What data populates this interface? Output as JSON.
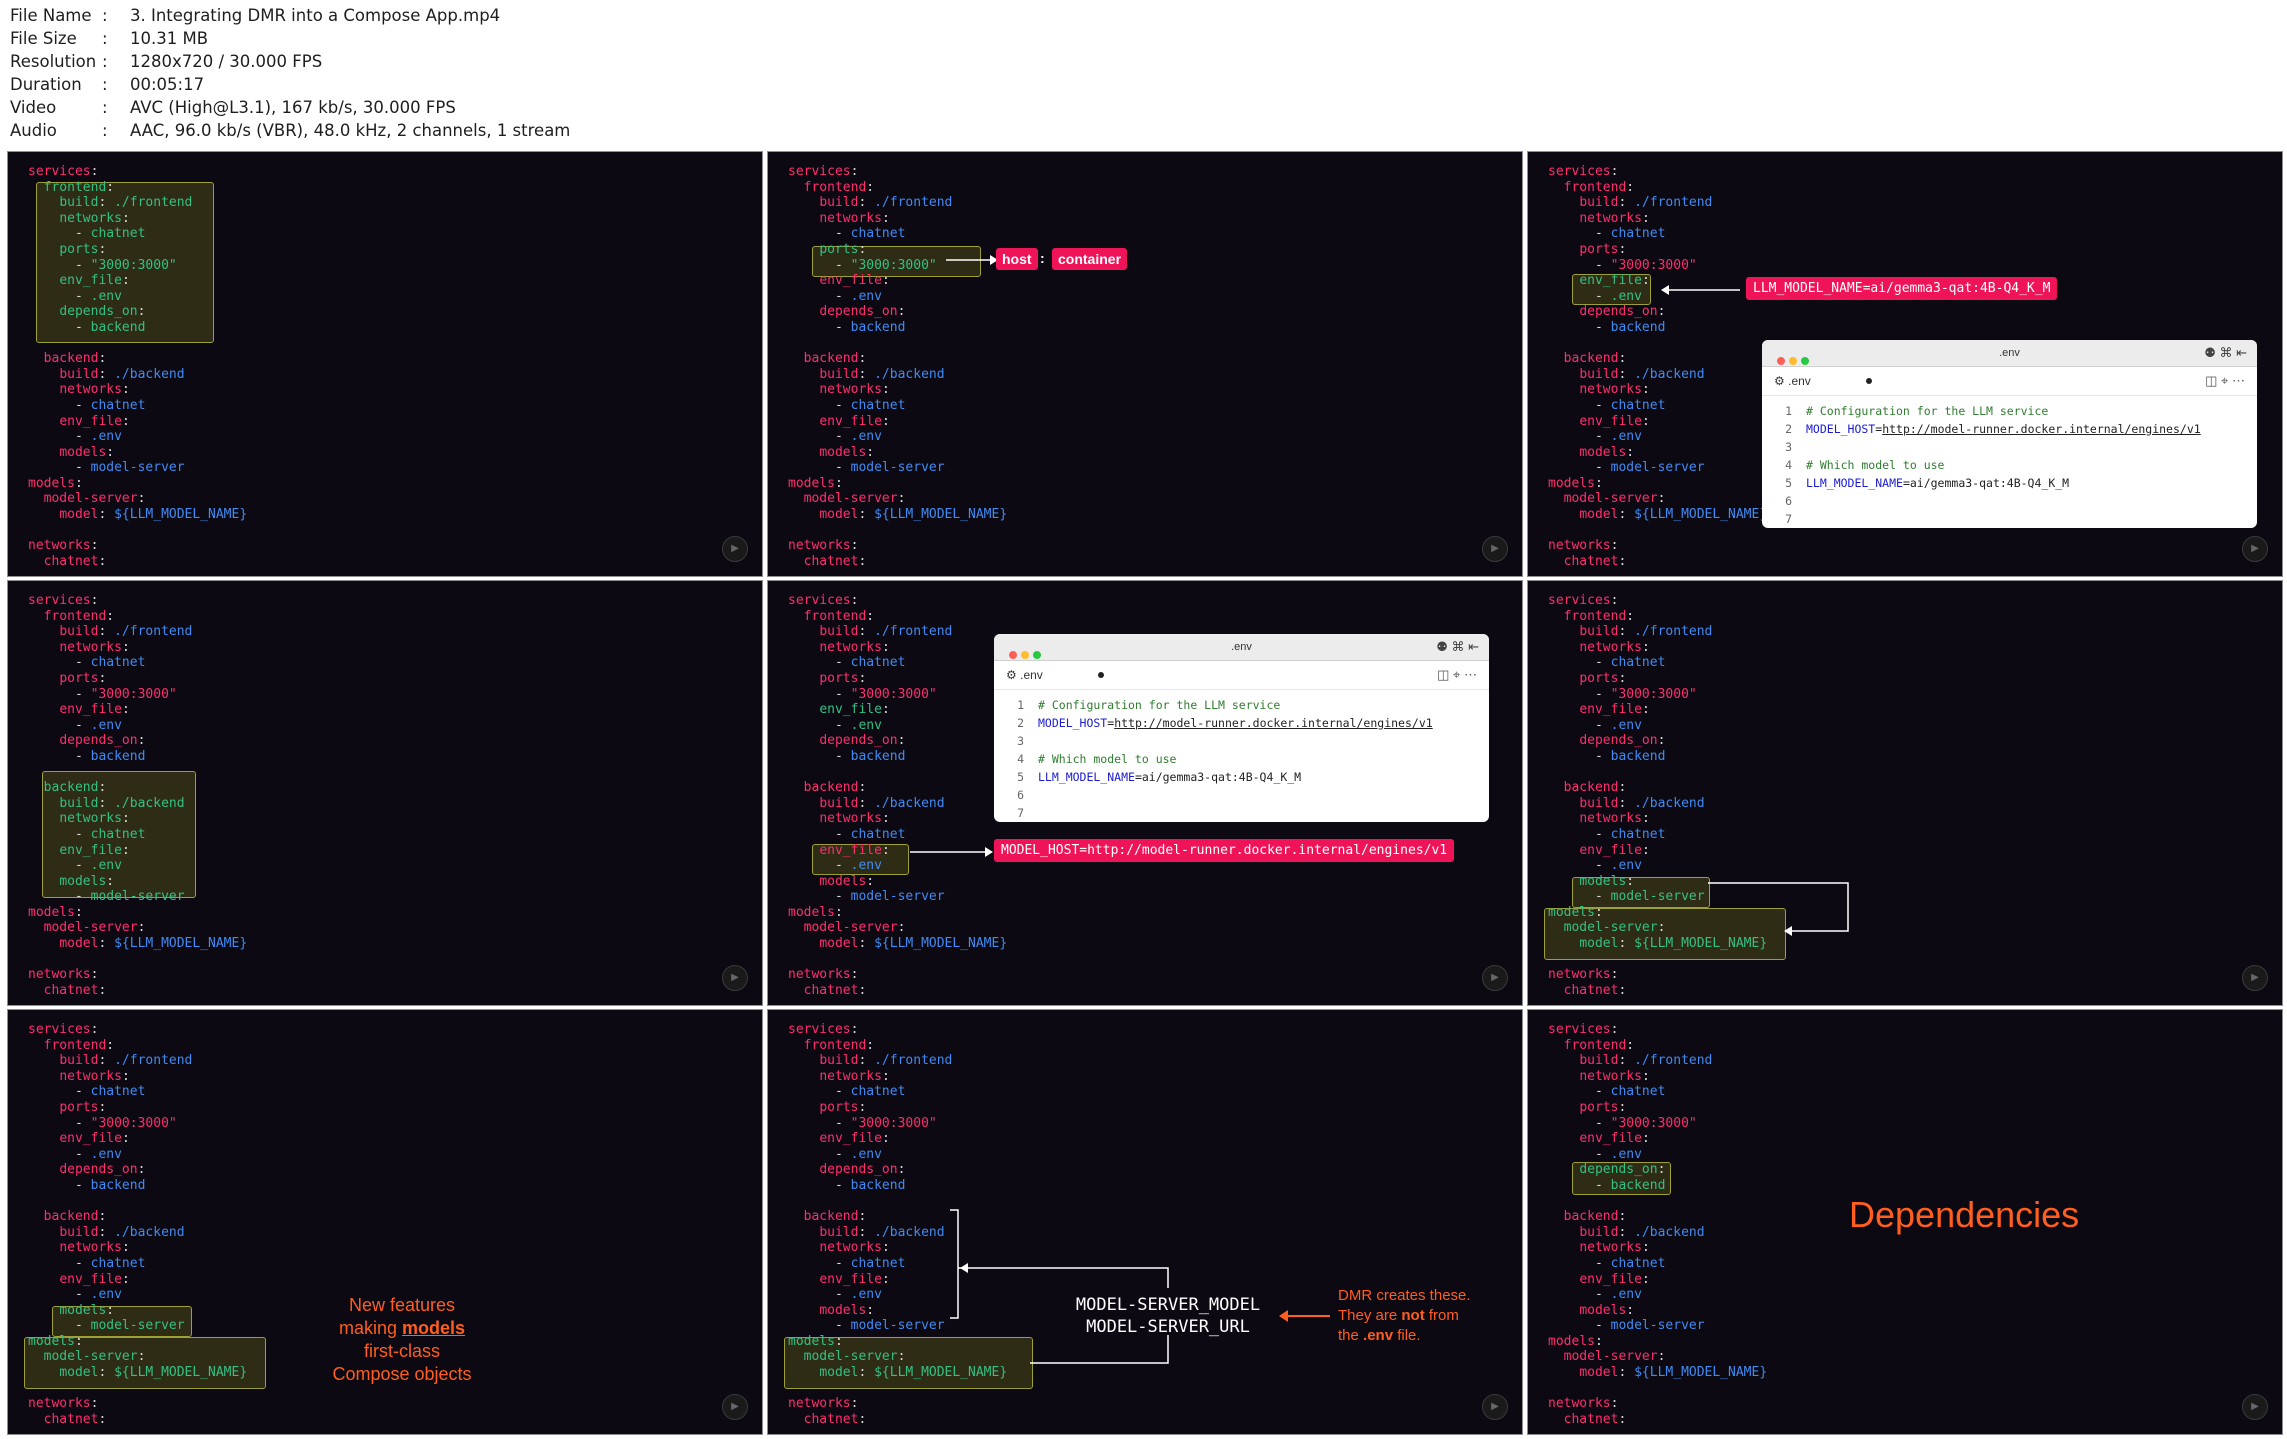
{
  "info": {
    "rows": [
      {
        "key": "File Name",
        "val": "3. Integrating DMR into a Compose App.mp4"
      },
      {
        "key": "File Size",
        "val": "10.31 MB"
      },
      {
        "key": "Resolution",
        "val": "1280x720 / 30.000 FPS"
      },
      {
        "key": "Duration",
        "val": "00:05:17"
      },
      {
        "key": "Video",
        "val": "AVC (High@L3.1), 167 kb/s, 30.000 FPS"
      },
      {
        "key": "Audio",
        "val": "AAC, 96.0 kb/s (VBR), 48.0 kHz, 2 channels, 1 stream"
      }
    ],
    "sep": ":"
  },
  "yaml": {
    "services": "services",
    "frontend": "frontend",
    "backend": "backend",
    "build": "build",
    "build_front": "./frontend",
    "build_back": "./backend",
    "networks": "networks",
    "chatnet": "chatnet",
    "ports": "ports",
    "port_val": "\"3000:3000\"",
    "env_file": "env_file",
    "env_val": ".env",
    "depends_on": "depends_on",
    "models": "models",
    "model_server": "model-server",
    "model": "model",
    "model_val": "${LLM_MODEL_NAME}",
    "colon": ":",
    "dash": "- "
  },
  "tags": {
    "host": "host",
    "colon": ":",
    "container": "container",
    "llm_model": "LLM_MODEL_NAME=ai/gemma3-qat:4B-Q4_K_M",
    "model_host": "MODEL_HOST=http://model-runner.docker.internal/engines/v1"
  },
  "env_window": {
    "title": ".env",
    "tab": ".env",
    "line1": "# Configuration for the LLM service",
    "line2_key": "MODEL_HOST",
    "line2_eq": "=",
    "line2_val": "http://model-runner.docker.internal/engines/v1",
    "line4": "# Which model to use",
    "line5_key": "LLM_MODEL_NAME",
    "line5_val": "=ai/gemma3-qat:4B-Q4_K_M",
    "lines": [
      "1",
      "2",
      "3",
      "4",
      "5",
      "6",
      "7"
    ]
  },
  "annotations": {
    "features_1": "New features",
    "features_2a": "making ",
    "features_2b": "models",
    "features_3": "first-class",
    "features_4": "Compose objects",
    "env_var_1": "MODEL-SERVER_MODEL",
    "env_var_2": "MODEL-SERVER_URL",
    "dmr_1": "DMR creates these.",
    "dmr_2a": "They are ",
    "dmr_2b": "not",
    "dmr_2c": " from",
    "dmr_3a": "the ",
    "dmr_3b": ".env",
    "dmr_3c": " file.",
    "dependencies": "Dependencies"
  },
  "colors": {
    "key": "#ff2e6d",
    "value": "#3f8bf3",
    "highlight_text": "#33c083",
    "tag_bg": "#ee1457",
    "accent": "#ff5e1f",
    "tile_bg": "#0c0913"
  },
  "icons": [
    "play-icon",
    "copilot-icon",
    "layout-icon",
    "split-icon",
    "lock-icon",
    "more-icon",
    "gear-icon"
  ]
}
